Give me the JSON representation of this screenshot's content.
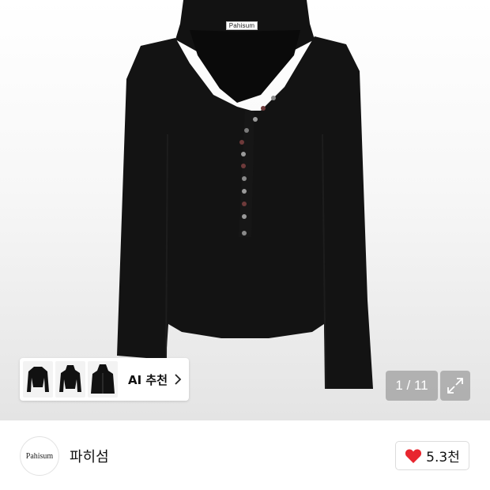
{
  "product_image": {
    "alt": "hoodie-product-photo",
    "brand_tag": "Pahisum",
    "background": "#f3f3f3",
    "garment_color": "#111111"
  },
  "ai_recommend": {
    "label": "AI 추천",
    "thumbnails": [
      "thumbnail-1",
      "thumbnail-2",
      "thumbnail-3"
    ],
    "icon": "chevron-right-icon"
  },
  "gallery": {
    "counter": "1 / 11",
    "expand_icon": "expand-icon"
  },
  "store": {
    "logo_text": "Pahisum",
    "name": "파히섬"
  },
  "like": {
    "icon": "heart-icon",
    "count": "5.3천",
    "color": "#e8262f"
  }
}
